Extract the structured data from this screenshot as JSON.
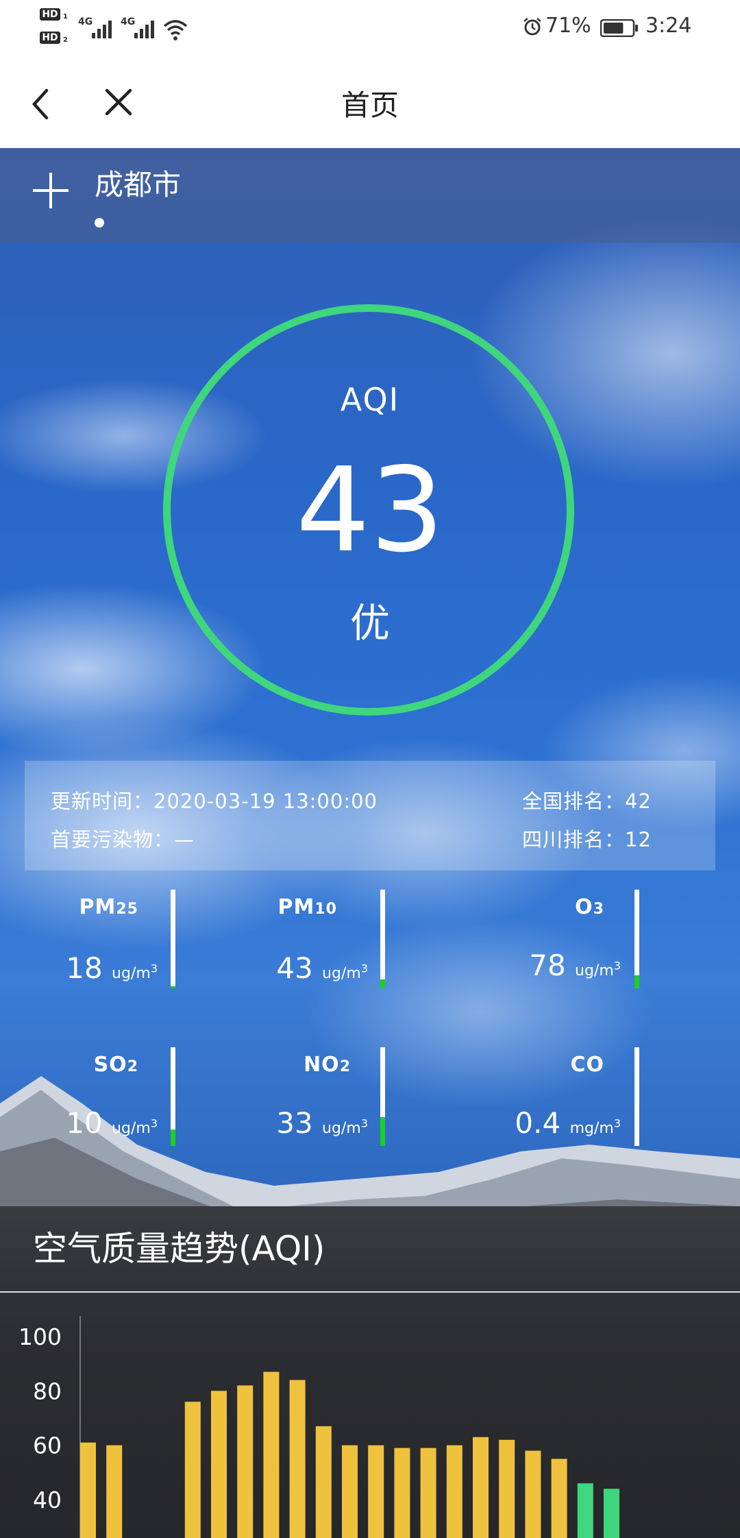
{
  "status_bar": {
    "hd_badges": [
      "HD",
      "HD"
    ],
    "hd_subs": [
      "1",
      "2"
    ],
    "network_1": "4G",
    "network_2": "4G",
    "battery_percent": "71%",
    "battery_level": 0.71,
    "time": "3:24",
    "icons": [
      "signal-icon",
      "wifi-icon",
      "alarm-icon",
      "battery-icon"
    ]
  },
  "nav": {
    "title": "首页",
    "back_icon": "chevron-left-icon",
    "close_icon": "close-icon"
  },
  "city": {
    "name": "成都市",
    "add_icon": "plus-icon"
  },
  "aqi": {
    "label": "AQI",
    "value": "43",
    "level": "优",
    "ring_color": "#3fd67e"
  },
  "info": {
    "update_time": "更新时间：2020-03-19 13:00:00",
    "main_pollutant": "首要污染物：—",
    "national_rank": "全国排名：42",
    "province_rank": "四川排名：12"
  },
  "pollutants": [
    {
      "name": "PM",
      "sub": "25",
      "value": "18",
      "unit": "ug/m",
      "unit_sup": "3",
      "level": 0.02
    },
    {
      "name": "PM",
      "sub": "10",
      "value": "43",
      "unit": "ug/m",
      "unit_sup": "3",
      "level": 0.09
    },
    {
      "name": "O",
      "sub": "3",
      "value": "78",
      "unit": "ug/m",
      "unit_sup": "3",
      "level": 0.13
    },
    {
      "name": "SO",
      "sub": "2",
      "value": "10",
      "unit": "ug/m",
      "unit_sup": "3",
      "level": 0.17
    },
    {
      "name": "NO",
      "sub": "2",
      "value": "33",
      "unit": "ug/m",
      "unit_sup": "3",
      "level": 0.29
    },
    {
      "name": "CO",
      "sub": "",
      "value": "0.4",
      "unit": "mg/m",
      "unit_sup": "3",
      "level": 0.0
    }
  ],
  "gauge_fill_color": "#19d11f",
  "trend": {
    "title": "空气质量趋势(AQI)"
  },
  "chart_data": {
    "type": "bar",
    "title": "空气质量趋势(AQI)",
    "xlabel": "",
    "ylabel": "",
    "yticks": [
      100,
      80,
      60,
      40
    ],
    "ylim": [
      40,
      100
    ],
    "values": [
      61,
      60,
      null,
      null,
      76,
      80,
      82,
      87,
      84,
      67,
      60,
      60,
      59,
      59,
      60,
      63,
      62,
      58,
      55,
      46,
      44
    ],
    "colors": [
      "#efc23e",
      "#efc23e",
      null,
      null,
      "#efc23e",
      "#efc23e",
      "#efc23e",
      "#efc23e",
      "#efc23e",
      "#efc23e",
      "#efc23e",
      "#efc23e",
      "#efc23e",
      "#efc23e",
      "#efc23e",
      "#efc23e",
      "#efc23e",
      "#efc23e",
      "#efc23e",
      "#3fd67e",
      "#3fd67e"
    ]
  }
}
